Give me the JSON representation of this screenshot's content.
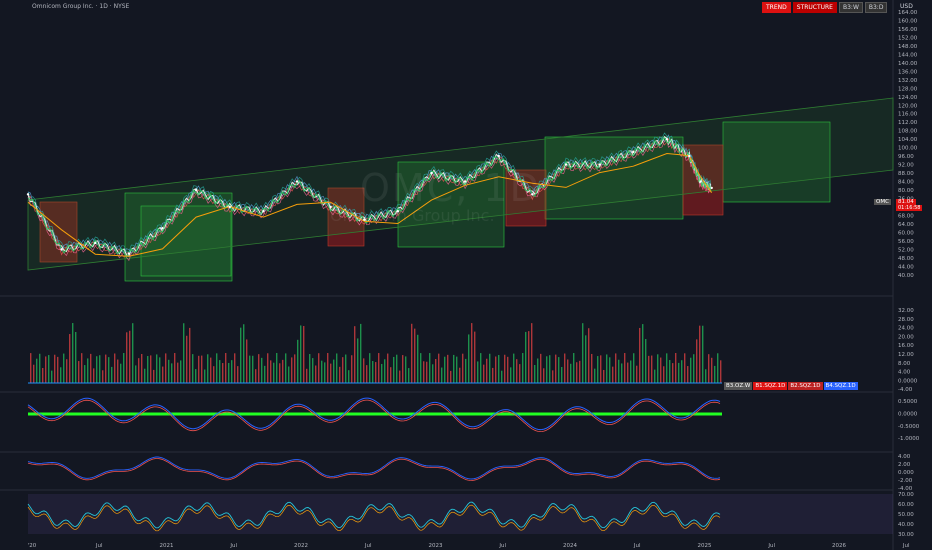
{
  "header": {
    "title": "Omnicom Group Inc. · 1D · NYSE",
    "badges": [
      "TREND",
      "STRUCTURE",
      "B3:W",
      "B3:D"
    ],
    "currency": "USD"
  },
  "watermark": {
    "ticker": "OMC, 1D",
    "name": "Omnicom Group Inc."
  },
  "price_label": {
    "ticker": "OMC",
    "last": "81.04",
    "countdown": "01:16:58"
  },
  "sub_legend": [
    "B3.OZ.W",
    "B1.SQZ.1D",
    "B2.SQZ.1D",
    "B4.SQZ.1D"
  ],
  "colors": {
    "background": "#131722",
    "up": "#22c55e",
    "down": "#ef4444",
    "zone_green": "#1e6b2e",
    "zone_red": "#a11d1d",
    "ma_orange": "#f59e0b",
    "channel": "#2f7d32"
  },
  "chart_data": [
    {
      "type": "line",
      "name": "price",
      "x": [
        "2020-01",
        "2020-04",
        "2020-07",
        "2020-10",
        "2021-01",
        "2021-04",
        "2021-07",
        "2021-10",
        "2022-01",
        "2022-04",
        "2022-07",
        "2022-10",
        "2023-01",
        "2023-04",
        "2023-07",
        "2023-10",
        "2024-01",
        "2024-04",
        "2024-07",
        "2024-10",
        "2024-12",
        "2025-01",
        "2025-02"
      ],
      "series": [
        {
          "values": [
            78,
            52,
            55,
            50,
            62,
            80,
            72,
            70,
            84,
            72,
            66,
            70,
            88,
            84,
            96,
            78,
            92,
            92,
            98,
            104,
            96,
            84,
            81
          ]
        }
      ],
      "ylim": [
        30,
        164
      ],
      "y_ticks": [
        "164.00",
        "160.00",
        "156.00",
        "152.00",
        "148.00",
        "144.00",
        "140.00",
        "136.00",
        "132.00",
        "128.00",
        "124.00",
        "120.00",
        "116.00",
        "112.00",
        "108.00",
        "104.00",
        "100.00",
        "96.00",
        "92.00",
        "88.00",
        "84.00",
        "80.00",
        "76.00",
        "72.00",
        "68.00",
        "64.00",
        "60.00",
        "56.00",
        "52.00",
        "48.00",
        "44.00",
        "40.00"
      ],
      "x_ticks": [
        "'20",
        "Jul",
        "2021",
        "Jul",
        "2022",
        "Jul",
        "2023",
        "Jul",
        "2024",
        "Jul",
        "2025",
        "Jul",
        "2026",
        "Jul"
      ]
    },
    {
      "type": "bar",
      "name": "volume",
      "y_ticks": [
        "32.00",
        "28.00",
        "24.00",
        "20.00",
        "16.00",
        "12.00",
        "8.00",
        "4.00",
        "0.0000",
        "-4.00"
      ]
    },
    {
      "type": "line",
      "name": "oscillator",
      "y_ticks": [
        "0.5000",
        "0.0000",
        "-0.5000",
        "-1.0000"
      ]
    },
    {
      "type": "line",
      "name": "macd",
      "y_ticks": [
        "4.00",
        "2.00",
        "0.000",
        "-2.00",
        "-4.00"
      ]
    },
    {
      "type": "line",
      "name": "rsi",
      "y_ticks": [
        "70.00",
        "60.00",
        "50.00",
        "40.00",
        "30.00"
      ]
    }
  ]
}
